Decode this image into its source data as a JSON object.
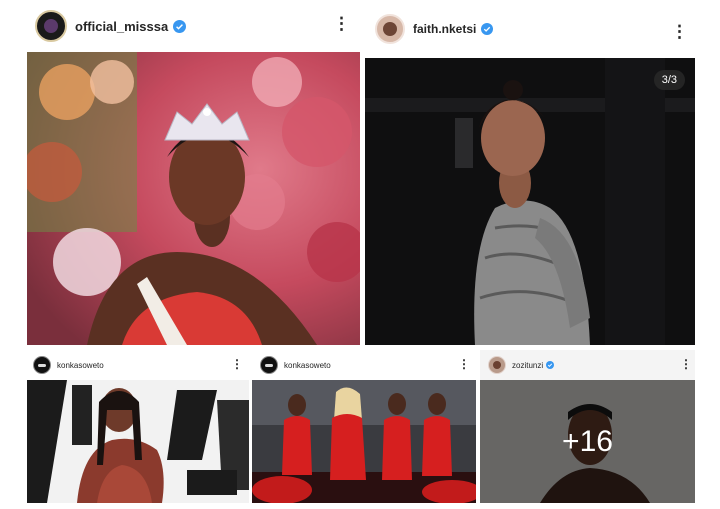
{
  "posts": [
    {
      "username": "official_misssa",
      "verified": true
    },
    {
      "username": "faith.nketsi",
      "verified": true,
      "counter": "3/3"
    },
    {
      "username": "konkasoweto",
      "verified": false
    },
    {
      "username": "konkasoweto",
      "verified": false
    },
    {
      "username": "zozitunzi",
      "verified": true,
      "more_label": "+16"
    }
  ],
  "colors": {
    "verified_badge": "#3897f0",
    "text": "#262626",
    "counter_bg": "#282828"
  },
  "icons": {
    "options": "more-options-icon",
    "verified": "verified-badge-icon"
  }
}
